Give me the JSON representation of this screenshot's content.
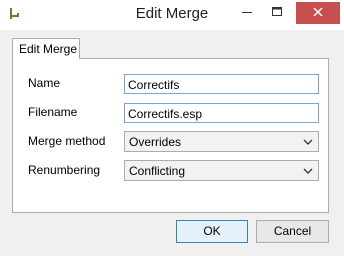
{
  "window": {
    "title": "Edit Merge"
  },
  "tabs": [
    {
      "label": "Edit Merge"
    }
  ],
  "form": {
    "name_label": "Name",
    "name_value": "Correctifs",
    "filename_label": "Filename",
    "filename_value": "Correctifs.esp",
    "merge_method_label": "Merge method",
    "merge_method_value": "Overrides",
    "renumbering_label": "Renumbering",
    "renumbering_value": "Conflicting"
  },
  "buttons": {
    "ok": "OK",
    "cancel": "Cancel"
  },
  "icons": {
    "app": "app-icon",
    "minimize": "minimize-icon",
    "maximize": "maximize-icon",
    "close": "close-icon"
  }
}
